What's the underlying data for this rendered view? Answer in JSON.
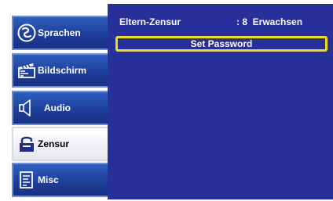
{
  "sidebar": {
    "items": [
      {
        "label": "Sprachen",
        "icon": "globe-icon"
      },
      {
        "label": "Bildschirm",
        "icon": "clapperboard-icon"
      },
      {
        "label": "Audio",
        "icon": "speaker-icon"
      },
      {
        "label": "Zensur",
        "icon": "lock-icon"
      },
      {
        "label": "Misc",
        "icon": "document-icon"
      }
    ],
    "active": "Zensur"
  },
  "content": {
    "setting_label": "Eltern-Zensur",
    "setting_value": ": 8  Erwachsen",
    "action_label": "Set Password"
  },
  "colors": {
    "panel": "#27309a",
    "highlight_border": "#f0e000",
    "tab_gradient_top": "#2f5fc0",
    "tab_gradient_bottom": "#173083"
  }
}
